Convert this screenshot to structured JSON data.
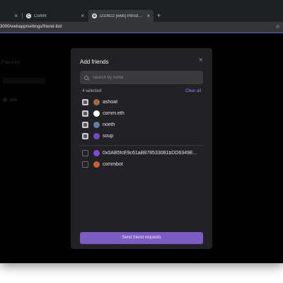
{
  "browser": {
    "tabs": [
      {
        "title": "",
        "active": false
      },
      {
        "title": "Comm",
        "active": false
      },
      {
        "title": "D10822 [web] Introduce",
        "active": true
      }
    ],
    "url": "3000/webapp/settings/friend-list/",
    "colors": {
      "accent_border": "#5b5cd6"
    }
  },
  "background": {
    "label": "Friend list"
  },
  "modal": {
    "title": "Add friends",
    "search_placeholder": "Search by name",
    "selected_count": "4 selected",
    "clear_all": "Clear all",
    "selected_users": [
      {
        "name": "ashoat",
        "checked": true,
        "avatar_color": "#9a6b4e"
      },
      {
        "name": "comm.eth",
        "checked": true,
        "avatar_color": "#ffffff"
      },
      {
        "name": "noeth",
        "checked": true,
        "avatar_color": "#5d7fa8"
      },
      {
        "name": "soup",
        "checked": true,
        "avatar_color": "#6a4cc4"
      }
    ],
    "other_users": [
      {
        "name": "0x0AB5fcE9c61aB878533081bDD6349E...",
        "checked": false,
        "avatar_color": "#7b4ed8"
      },
      {
        "name": "commbot",
        "checked": false,
        "avatar_color": "#c9603a"
      }
    ],
    "send_button": "Send friend requests",
    "colors": {
      "button": "#7b5cc4",
      "clear_all": "#8d8ff5"
    }
  }
}
